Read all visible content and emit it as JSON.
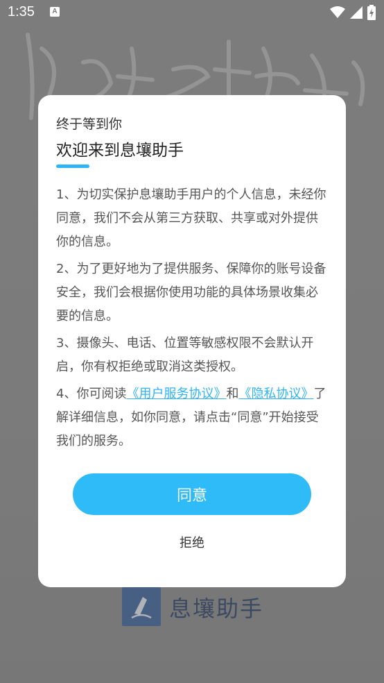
{
  "status_bar": {
    "time": "1:35",
    "notification_icon": "a-icon",
    "notification_glyph": "A",
    "icons": [
      "wifi-icon",
      "signal-icon",
      "battery-charging-icon"
    ]
  },
  "background": {
    "app_name": "息壤助手",
    "logo_icon": "pen-logo-icon"
  },
  "dialog": {
    "greeting": "终于等到你",
    "title": "欢迎来到息壤助手",
    "paragraphs": {
      "p1": "1、为切实保护息壤助手用户的个人信息，未经你同意，我们不会从第三方获取、共享或对外提供你的信息。",
      "p2": "2、为了更好地为了提供服务、保障你的账号设备安全，我们会根据你使用功能的具体场景收集必要的信息。",
      "p3": "3、摄像头、电话、位置等敏感权限不会默认开启，你有权拒绝或取消这类授权。",
      "p4_prefix": "4、你可阅读",
      "p4_link1": "《用户服务协议》",
      "p4_and": "和",
      "p4_link2": "《隐私协议》",
      "p4_suffix": "了解详细信息，如你同意，请点击“同意”开始接受我们的服务。"
    },
    "agree_label": "同意",
    "reject_label": "拒绝"
  },
  "colors": {
    "accent": "#2fbbf7",
    "overlay": "#7b7b7b",
    "dialog_bg": "#ffffff"
  }
}
